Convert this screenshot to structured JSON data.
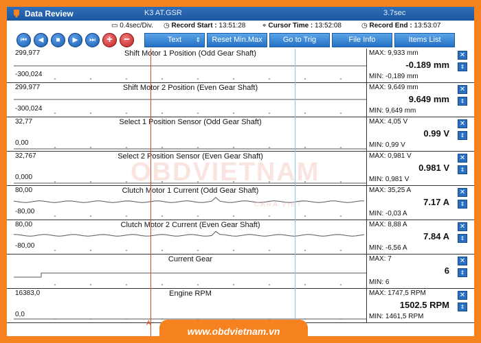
{
  "window": {
    "title": "Data Review",
    "file": "K3 AT.GSR",
    "duration": "3.7sec"
  },
  "info": {
    "scale": "0.4sec/Div.",
    "record_start_label": "Record Start :",
    "record_start": "13:51:28",
    "cursor_time_label": "Cursor Time :",
    "cursor_time": "13:52:08",
    "record_end_label": "Record End :",
    "record_end": "13:53:07"
  },
  "toolbar": {
    "first": "⏮",
    "prev": "◀",
    "stop": "■",
    "play": "▶",
    "next": "⏭",
    "zoom_in": "+",
    "zoom_out": "−",
    "text_label": "Text",
    "reset_label": "Reset Min.Max",
    "gototrig_label": "Go to Trig",
    "fileinfo_label": "File Info",
    "itemslist_label": "Items List"
  },
  "cursors": {
    "a": "A",
    "b": "B"
  },
  "watermark": {
    "main": "OBDVIETNAM",
    "sub": "CARA VIET"
  },
  "footer": {
    "url": "www.obdvietnam.vn"
  },
  "rows": [
    {
      "title": "Shift Motor 1 Position (Odd Gear Shaft)",
      "ymax": "299,977",
      "ymin": "-300,024",
      "max": "MAX: 9,933 mm",
      "value": "-0.189 mm",
      "min": "MIN: -0,189 mm",
      "level": 0.5
    },
    {
      "title": "Shift Motor 2 Position (Even Gear Shaft)",
      "ymax": "299,977",
      "ymin": "-300,024",
      "max": "MAX: 9,649 mm",
      "value": "9.649 mm",
      "min": "MIN: 9,649 mm",
      "level": 0.52
    },
    {
      "title": "Select 1 Position Sensor (Odd Gear Shaft)",
      "ymax": "32,77",
      "ymin": "0,00",
      "max": "MAX: 4,05 V",
      "value": "0.99 V",
      "min": "MIN: 0,99 V",
      "level": 0.07
    },
    {
      "title": "Select 2 Position Sensor (Even Gear Shaft)",
      "ymax": "32,767",
      "ymin": "0,000",
      "max": "MAX: 0,981 V",
      "value": "0.981 V",
      "min": "MIN: 0,981 V",
      "level": 0.06
    },
    {
      "title": "Clutch Motor 1 Current (Odd Gear Shaft)",
      "ymax": "80,00",
      "ymin": "-80,00",
      "max": "MAX: 35,25 A",
      "value": "7.17 A",
      "min": "MIN: -0,03 A",
      "level": 0.53
    },
    {
      "title": "Clutch Motor 2 Current (Even Gear Shaft)",
      "ymax": "80,00",
      "ymin": "-80,00",
      "max": "MAX: 8,88 A",
      "value": "7.84 A",
      "min": "MIN: -6,56 A",
      "level": 0.55
    },
    {
      "title": "Current Gear",
      "ymax": "",
      "ymin": "",
      "max": "MAX: 7",
      "value": "6",
      "min": "MIN: 6",
      "level": 0.45
    },
    {
      "title": "Engine RPM",
      "ymax": "16383,0",
      "ymin": "0,0",
      "max": "MAX: 1747,5 RPM",
      "value": "1502.5 RPM",
      "min": "MIN: 1461,5 RPM",
      "level": 0.1
    }
  ]
}
